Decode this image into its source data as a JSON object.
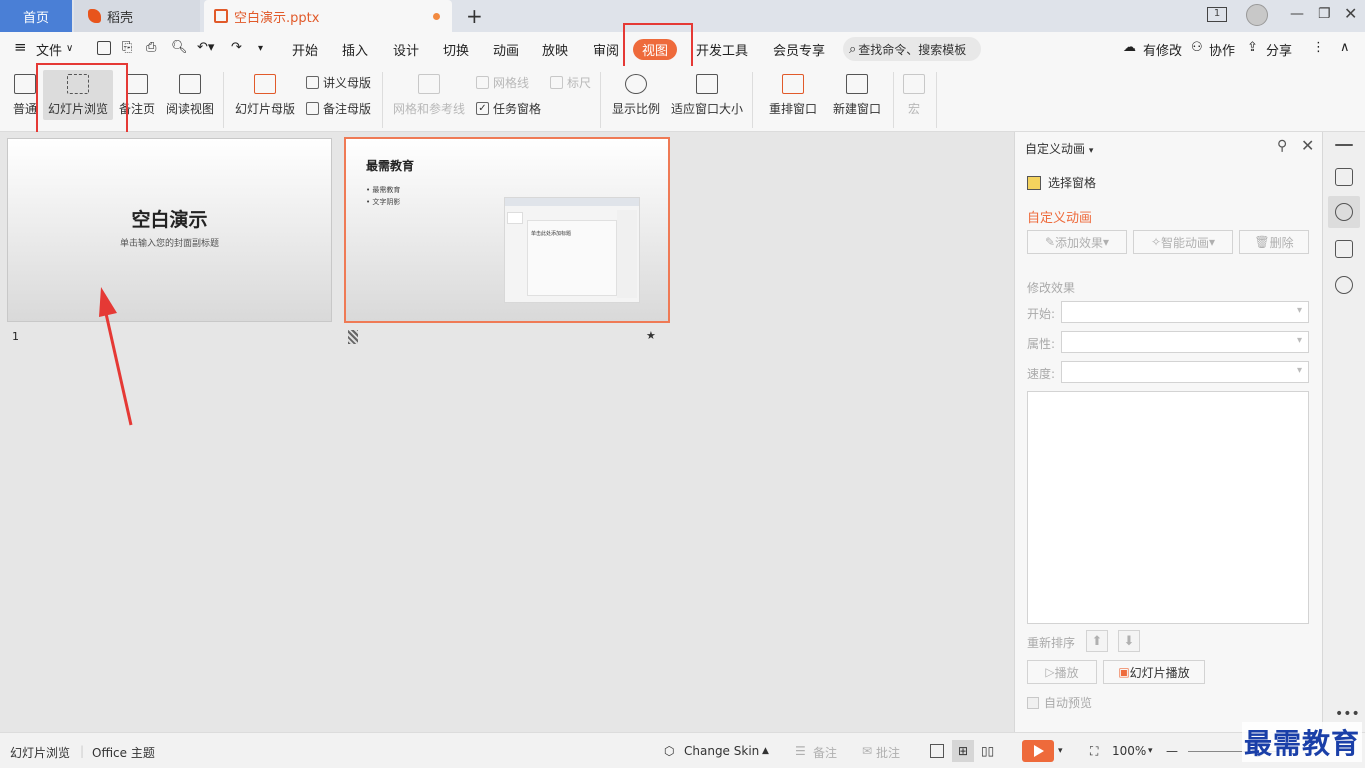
{
  "tabs": {
    "home": "首页",
    "daoke": "稻壳",
    "file": "空白演示.pptx",
    "add": "+",
    "window_badge": "1"
  },
  "menu": {
    "file": "文件",
    "items": [
      "开始",
      "插入",
      "设计",
      "切换",
      "动画",
      "放映",
      "审阅",
      "视图",
      "开发工具",
      "会员专享"
    ],
    "active": "视图",
    "search_placeholder": "查找命令、搜索模板",
    "revise": "有修改",
    "collab": "协作",
    "share": "分享"
  },
  "ribbon": {
    "normal": "普通",
    "slide_browse": "幻灯片浏览",
    "notes_page": "备注页",
    "reading_view": "阅读视图",
    "slide_master": "幻灯片母版",
    "handout_master": "讲义母版",
    "notes_master": "备注母版",
    "grid_guides": "网格和参考线",
    "gridlines": "网格线",
    "ruler": "标尺",
    "task_pane": "任务窗格",
    "zoom": "显示比例",
    "fit_window": "适应窗口大小",
    "arrange": "重排窗口",
    "new_window": "新建窗口",
    "macro": "宏"
  },
  "slides": [
    {
      "number": "1",
      "title": "空白演示",
      "subtitle": "单击输入您的封面副标题"
    },
    {
      "number": "",
      "title": "最需教育",
      "bullets": [
        "• 最需教育",
        "• 文字阴影"
      ],
      "mini_title": "单击此处添加标题",
      "star": "★"
    }
  ],
  "panel": {
    "title": "自定义动画",
    "select_pane": "选择窗格",
    "heading": "自定义动画",
    "add_effect": "添加效果",
    "smart_anim": "智能动画",
    "delete": "删除",
    "modify": "修改效果",
    "start": "开始:",
    "property": "属性:",
    "speed": "速度:",
    "reorder": "重新排序",
    "play": "播放",
    "slideshow": "幻灯片播放",
    "auto_preview": "自动预览"
  },
  "status": {
    "mode": "幻灯片浏览",
    "theme": "Office 主题",
    "skin": "Change Skin",
    "notes": "备注",
    "comments": "批注",
    "zoom": "100%"
  },
  "watermark": "最需教育",
  "colors": {
    "accent": "#ee6a3b",
    "highlight": "#e53935",
    "home_tab": "#4a7fd6"
  }
}
